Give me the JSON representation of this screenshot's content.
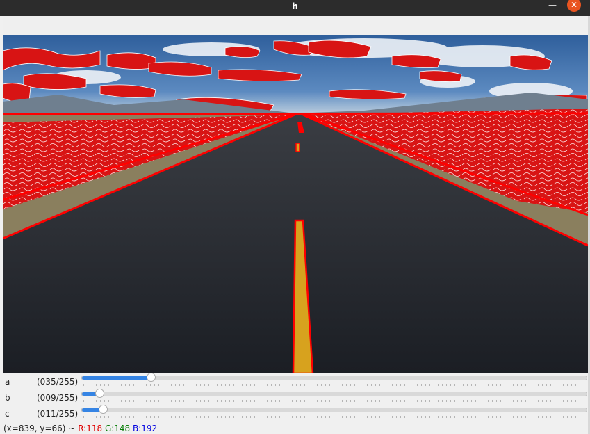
{
  "window": {
    "title": "h",
    "minimize_icon": "minimize-icon",
    "close_icon": "close-icon"
  },
  "image": {
    "description_icon": "road-edge-detection-image"
  },
  "trackbars": [
    {
      "name": "a",
      "value_text": "(035/255)",
      "value": 35,
      "max": 255
    },
    {
      "name": "b",
      "value_text": "(009/255)",
      "value": 9,
      "max": 255
    },
    {
      "name": "c",
      "value_text": "(011/255)",
      "value": 11,
      "max": 255
    }
  ],
  "status": {
    "coords": "(x=839, y=66) ~",
    "r": "R:118",
    "g": "G:148",
    "b": "B:192"
  },
  "colors": {
    "accent": "#3584e4",
    "close": "#e95420",
    "edge": "#ff0000"
  }
}
